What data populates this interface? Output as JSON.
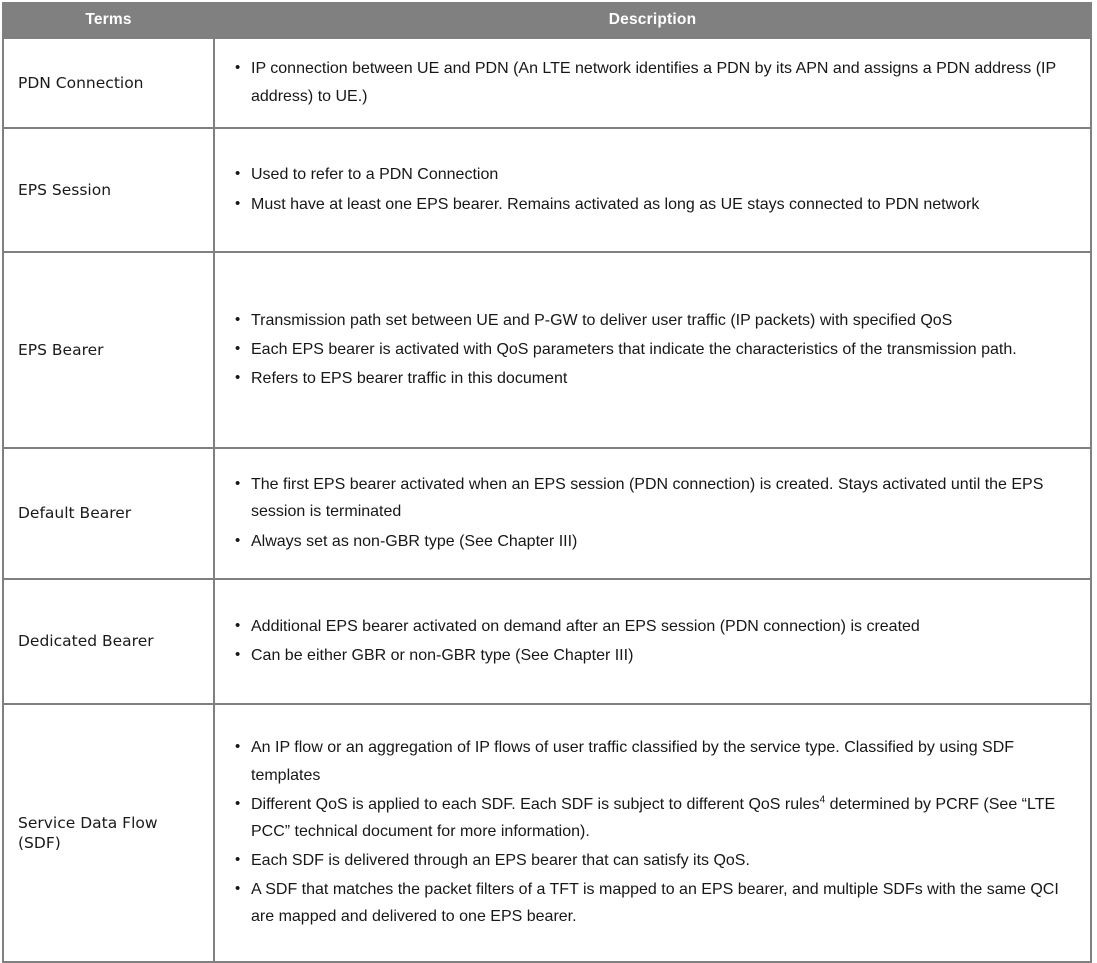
{
  "table": {
    "headers": {
      "terms": "Terms",
      "description": "Description"
    },
    "colors": {
      "header_background": "#808080",
      "header_text": "#ffffff",
      "border": "#808080",
      "cell_background": "#ffffff",
      "body_text": "#171717"
    },
    "rows": [
      {
        "term": "PDN Connection",
        "bullets": [
          "IP connection between UE and PDN (An LTE network identifies a PDN by its APN and assigns a PDN address (IP address) to UE.)"
        ]
      },
      {
        "term": "EPS Session",
        "bullets": [
          "Used to refer to a PDN Connection",
          "Must have at least one EPS bearer. Remains activated as long as UE stays connected to PDN network"
        ]
      },
      {
        "term": "EPS Bearer",
        "bullets": [
          "Transmission path set between UE and P-GW to deliver user traffic (IP packets) with specified QoS",
          "Each EPS bearer is activated with QoS parameters that indicate the characteristics of the transmission path.",
          "Refers to EPS bearer traffic in this document"
        ]
      },
      {
        "term": "Default Bearer",
        "bullets": [
          "The first EPS bearer activated when an EPS session (PDN connection) is created. Stays activated until the EPS session is terminated",
          "Always set as non-GBR type (See Chapter III)"
        ]
      },
      {
        "term": "Dedicated Bearer",
        "bullets": [
          "Additional EPS bearer activated on demand after an EPS session (PDN connection) is created",
          "Can be either GBR or non-GBR type (See Chapter III)"
        ]
      },
      {
        "term": "Service Data Flow (SDF)",
        "bullets": [
          "An IP flow or an aggregation of IP flows of user traffic classified by the service type. Classified by using SDF templates",
          "Each SDF is delivered through an EPS bearer that can satisfy its QoS.",
          "A SDF that matches the packet filters of a TFT is mapped to an EPS bearer, and multiple SDFs with the same QCI are mapped and delivered to one EPS bearer."
        ],
        "bullet_with_footnote": {
          "before": "Different QoS is applied to each SDF. Each SDF is subject to different QoS rules",
          "footnote_marker": "4",
          "after": " determined by PCRF (See “LTE PCC” technical document for more information)."
        }
      }
    ]
  }
}
